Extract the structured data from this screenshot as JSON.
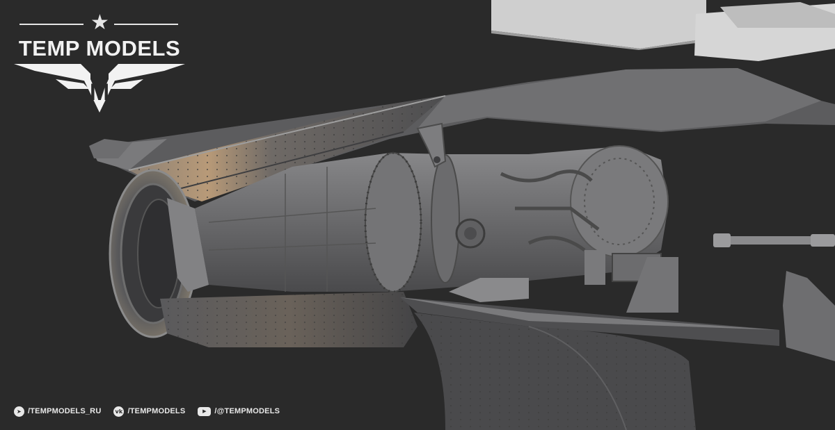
{
  "brand": {
    "name": "TEMP MODELS",
    "emblem_letter": "M"
  },
  "social": [
    {
      "icon": "telegram-icon",
      "label": "/TEMPMODELS_RU"
    },
    {
      "icon": "vk-icon",
      "label": "/TEMPMODELS"
    },
    {
      "icon": "youtube-icon",
      "label": "/@TEMPMODELS"
    }
  ],
  "colors": {
    "background": "#2a2a2a",
    "model_gray": "#6f6f6f",
    "highlight": "#c9a67a",
    "logo": "#f2f2f2"
  }
}
